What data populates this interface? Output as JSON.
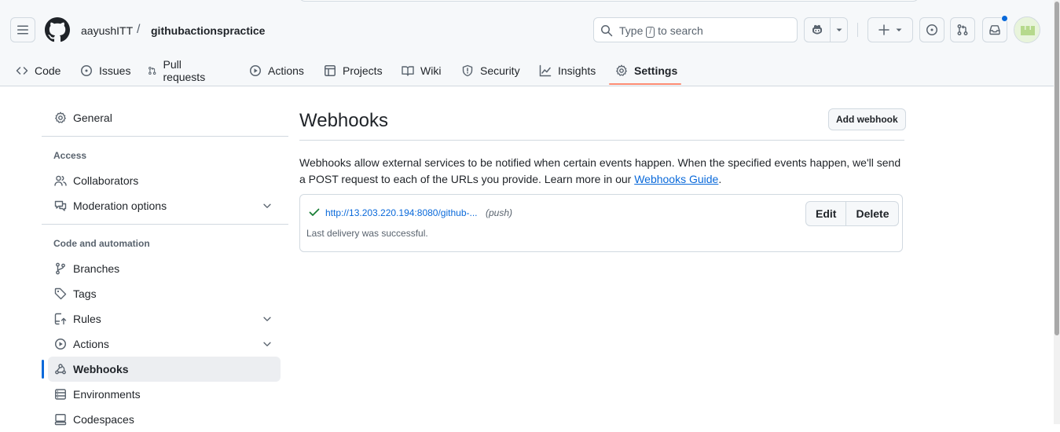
{
  "header": {
    "owner": "aayushITT",
    "separator": "/",
    "repo": "githubactionspractice",
    "search": {
      "prefix": "Type",
      "key": "/",
      "suffix": "to search"
    }
  },
  "tabs": [
    {
      "label": "Code",
      "icon": "code-icon"
    },
    {
      "label": "Issues",
      "icon": "issue-opened-icon"
    },
    {
      "label": "Pull requests",
      "icon": "git-pull-request-icon"
    },
    {
      "label": "Actions",
      "icon": "play-icon"
    },
    {
      "label": "Projects",
      "icon": "table-icon"
    },
    {
      "label": "Wiki",
      "icon": "book-icon"
    },
    {
      "label": "Security",
      "icon": "shield-icon"
    },
    {
      "label": "Insights",
      "icon": "graph-icon"
    },
    {
      "label": "Settings",
      "icon": "gear-icon",
      "selected": true
    }
  ],
  "sidebar": {
    "general": "General",
    "access_heading": "Access",
    "collaborators": "Collaborators",
    "moderation": "Moderation options",
    "code_automation_heading": "Code and automation",
    "branches": "Branches",
    "tags": "Tags",
    "rules": "Rules",
    "actions": "Actions",
    "webhooks": "Webhooks",
    "environments": "Environments",
    "codespaces": "Codespaces"
  },
  "main": {
    "title": "Webhooks",
    "add_button": "Add webhook",
    "description": "Webhooks allow external services to be notified when certain events happen. When the specified events happen, we'll send a POST request to each of the URLs you provide. Learn more in our ",
    "guide_link": "Webhooks Guide",
    "description_end": ".",
    "webhook": {
      "url": "http://13.203.220.194:8080/github-...",
      "events": "(push)",
      "status": "Last delivery was successful.",
      "edit_label": "Edit",
      "delete_label": "Delete"
    }
  },
  "colors": {
    "accent": "#0969da",
    "tab_underline": "#fd8c73",
    "success": "#1a7f37",
    "border": "#d1d9e0"
  }
}
